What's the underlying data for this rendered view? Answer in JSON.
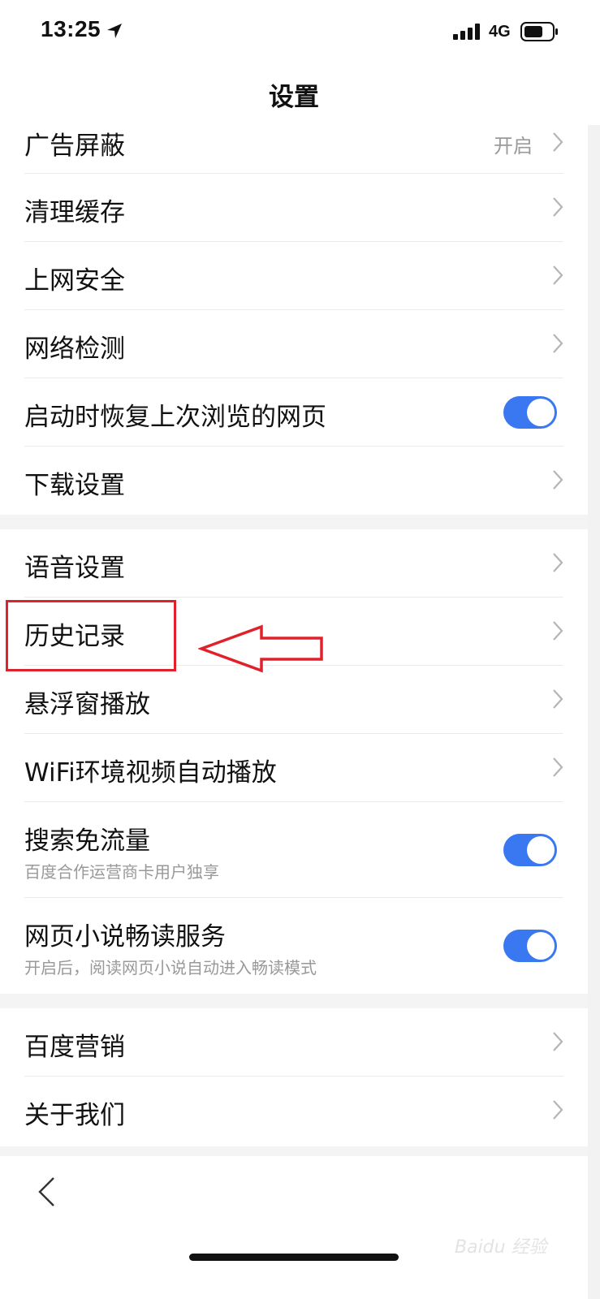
{
  "status_bar": {
    "time": "13:25",
    "network": "4G"
  },
  "nav": {
    "title": "设置"
  },
  "settings": {
    "ad_block": {
      "label": "广告屏蔽",
      "value": "开启"
    },
    "clear_cache": {
      "label": "清理缓存"
    },
    "web_security": {
      "label": "上网安全"
    },
    "network_check": {
      "label": "网络检测"
    },
    "restore_last": {
      "label": "启动时恢复上次浏览的网页",
      "enabled": true
    },
    "download": {
      "label": "下载设置"
    },
    "voice": {
      "label": "语音设置"
    },
    "history": {
      "label": "历史记录"
    },
    "float_window": {
      "label": "悬浮窗播放"
    },
    "wifi_autoplay": {
      "label": "WiFi环境视频自动播放"
    },
    "search_free_data": {
      "label": "搜索免流量",
      "subtitle": "百度合作运营商卡用户独享",
      "enabled": true
    },
    "novel_reader": {
      "label": "网页小说畅读服务",
      "subtitle": "开启后，阅读网页小说自动进入畅读模式",
      "enabled": true
    },
    "baidu_marketing": {
      "label": "百度营销"
    },
    "about": {
      "label": "关于我们"
    }
  },
  "watermark": {
    "text": "Baidu 经验"
  },
  "colors": {
    "accent_toggle": "#3978f0",
    "annotation_red": "#e0202a"
  }
}
